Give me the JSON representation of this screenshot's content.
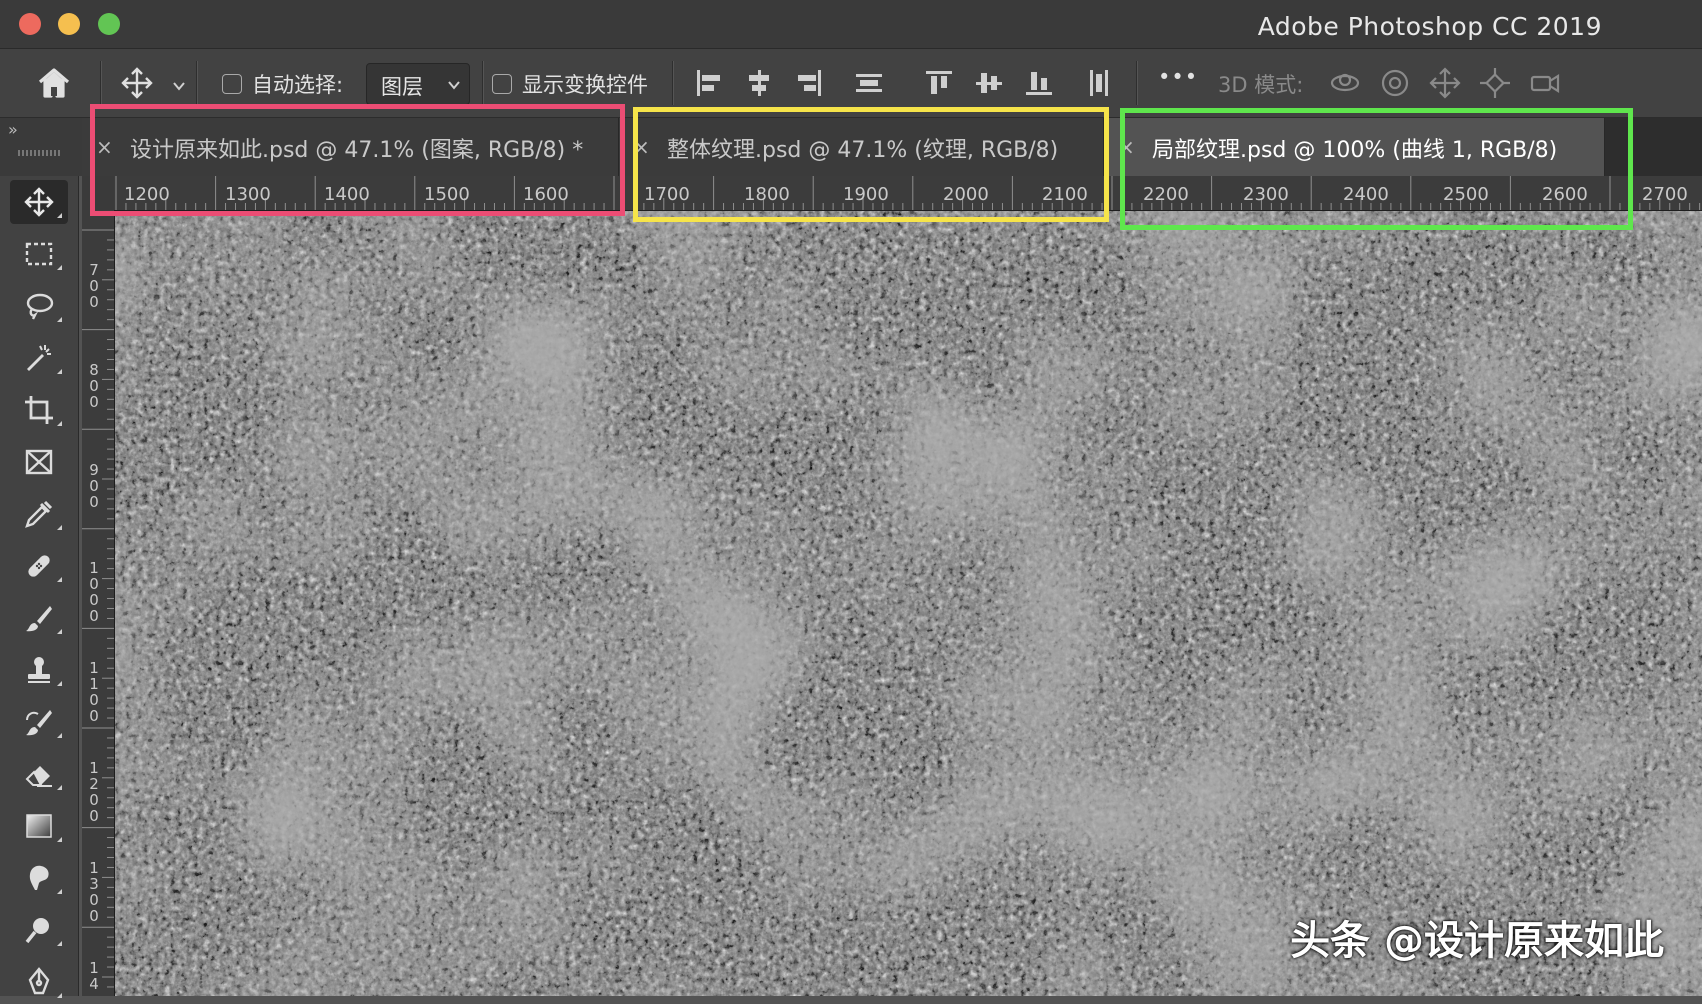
{
  "window": {
    "title": "Adobe Photoshop CC 2019"
  },
  "options_bar": {
    "auto_select_label": "自动选择:",
    "auto_select_target": "图层",
    "show_transform_label": "显示变换控件",
    "mode_3d_label": "3D 模式:",
    "more_label": "•••"
  },
  "tabs": [
    {
      "close": "×",
      "title": "设计原来如此.psd @ 47.1% (图案, RGB/8) *",
      "highlight": "#ec4d74"
    },
    {
      "close": "×",
      "title": "整体纹理.psd @ 47.1% (纹理, RGB/8)",
      "highlight": "#f6e44a"
    },
    {
      "close": "×",
      "title": "局部纹理.psd @ 100% (曲线 1, RGB/8)",
      "highlight": "#5fe64d"
    }
  ],
  "horizontal_ruler": [
    "1200",
    "1300",
    "1400",
    "1500",
    "1600",
    "1700",
    "1800",
    "1900",
    "2000",
    "2100",
    "2200",
    "2300",
    "2400",
    "2500",
    "2600",
    "2700"
  ],
  "vertical_ruler": [
    [
      "7",
      "0",
      "0"
    ],
    [
      "8",
      "0",
      "0"
    ],
    [
      "9",
      "0",
      "0"
    ],
    [
      "1",
      "0",
      "0",
      "0"
    ],
    [
      "1",
      "1",
      "0",
      "0"
    ],
    [
      "1",
      "2",
      "0",
      "0"
    ],
    [
      "1",
      "3",
      "0",
      "0"
    ],
    [
      "1",
      "4"
    ]
  ],
  "left_panel_toggle": "»",
  "tools": [
    "move-tool",
    "marquee-tool",
    "lasso-tool",
    "magic-wand-tool",
    "crop-tool",
    "frame-tool",
    "eyedropper-tool",
    "healing-brush-tool",
    "brush-tool",
    "clone-stamp-tool",
    "history-brush-tool",
    "eraser-tool",
    "gradient-tool",
    "smudge-tool",
    "dodge-tool",
    "pen-tool"
  ],
  "watermark": "头条 @设计原来如此",
  "colors": {
    "accent_pink": "#ec4d74",
    "accent_yellow": "#f6e44a",
    "accent_green": "#5fe64d"
  }
}
